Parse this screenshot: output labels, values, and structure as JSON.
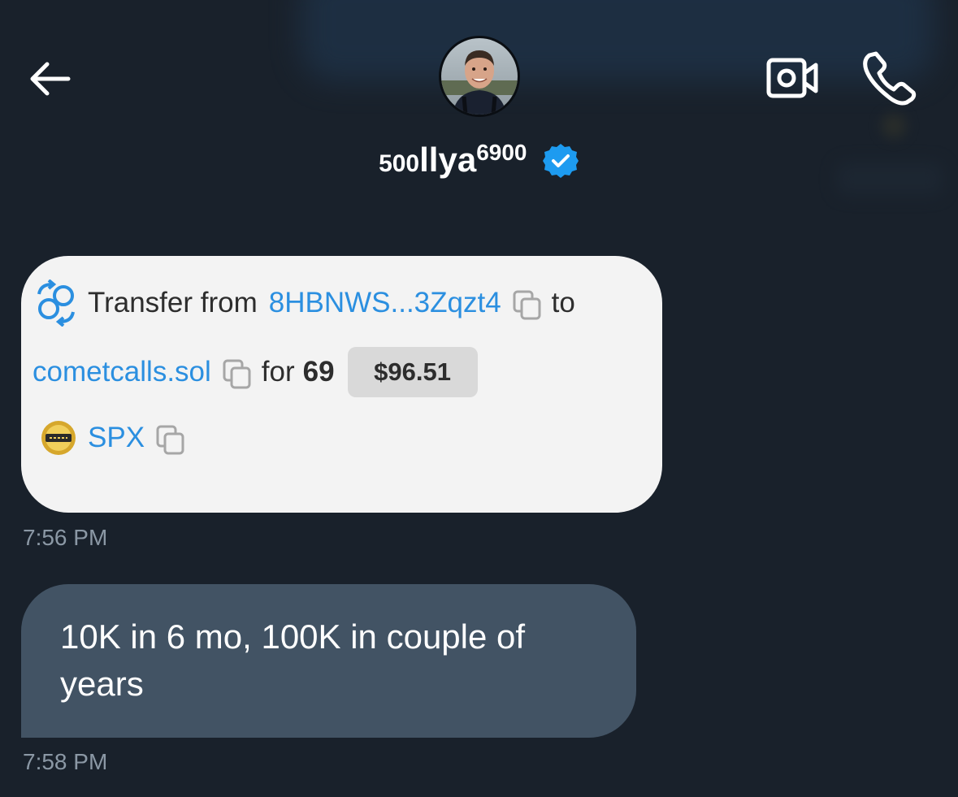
{
  "header": {
    "back_icon": "arrow-left-icon",
    "video_icon": "video-call-icon",
    "call_icon": "phone-icon",
    "name_prefix": "500",
    "name_main": "llya",
    "name_suffix": "6900",
    "verified_icon": "verified-badge-icon",
    "verified_color": "#1d9bf0"
  },
  "transfer_card": {
    "icon": "transfer-icon",
    "from_label": "Transfer from",
    "from_address": "8HBNWS...3Zqzt4",
    "to_label": "to",
    "to_address": "cometcalls.sol",
    "for_label": "for",
    "amount": "69",
    "usd_value": "$96.51",
    "token_symbol": "SPX",
    "link_color": "#2b8fe0"
  },
  "messages": [
    {
      "type": "transfer",
      "time": "7:56 PM"
    },
    {
      "type": "text",
      "text": "10K in 6 mo, 100K in couple of years",
      "time": "7:58 PM"
    }
  ]
}
